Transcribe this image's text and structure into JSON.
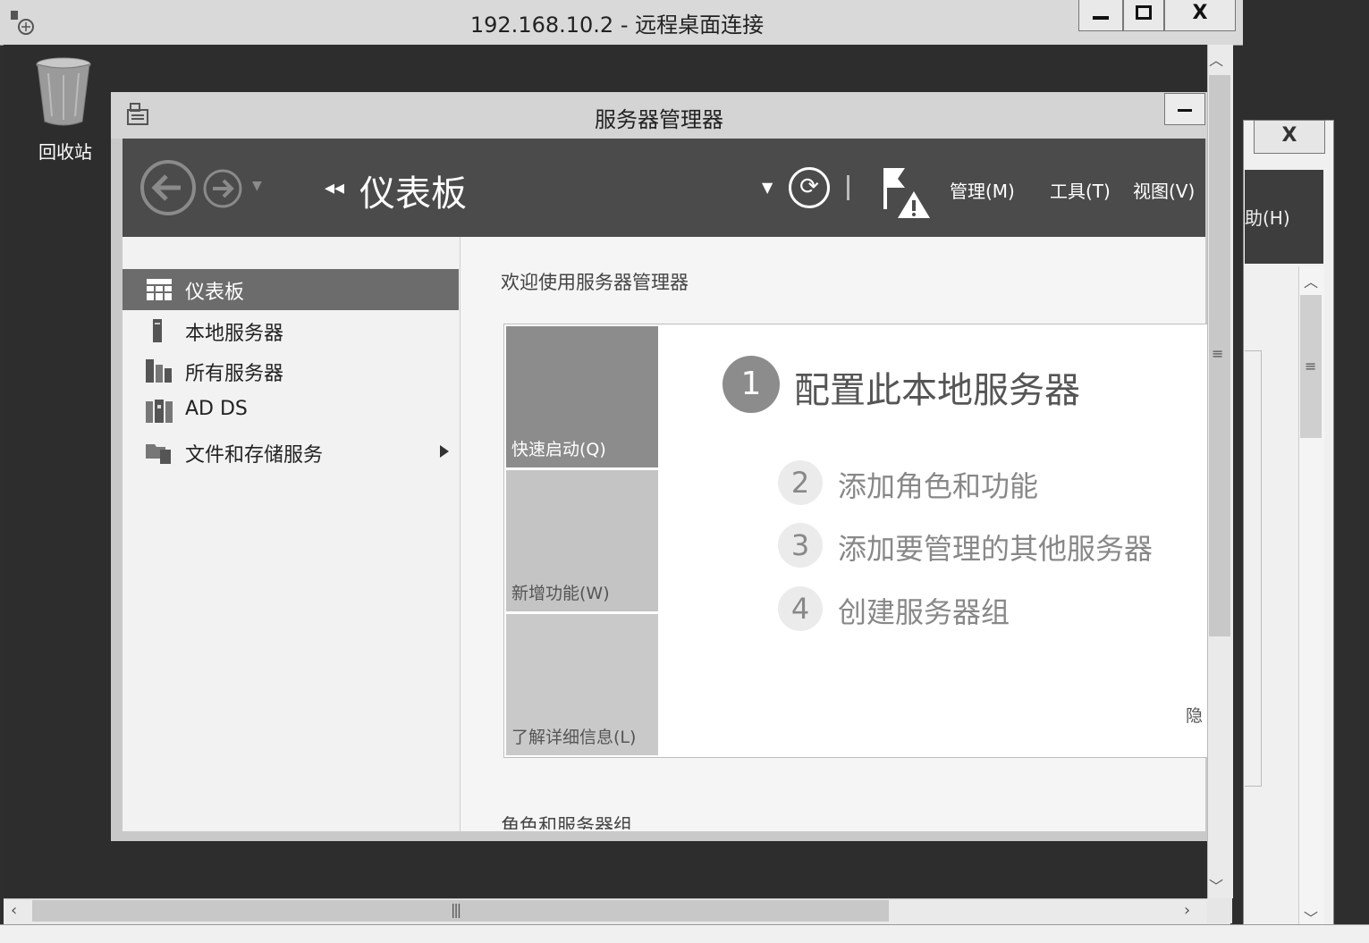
{
  "rdp": {
    "title": "192.168.10.2 - 远程桌面连接",
    "minimize": "▁",
    "maximize": "□",
    "close": "X"
  },
  "desktop": {
    "recycle_bin_label": "回收站"
  },
  "background_window": {
    "close": "X",
    "help_menu_partial": "助(H)"
  },
  "server_manager": {
    "title": "服务器管理器",
    "breadcrumb": "仪表板",
    "menus": [
      "管理(M)",
      "工具(T)",
      "视图(V)"
    ],
    "nav": [
      {
        "label": "仪表板",
        "icon": "dashboard-icon",
        "selected": true
      },
      {
        "label": "本地服务器",
        "icon": "local-server-icon",
        "selected": false
      },
      {
        "label": "所有服务器",
        "icon": "all-servers-icon",
        "selected": false
      },
      {
        "label": "AD DS",
        "icon": "ad-ds-icon",
        "selected": false
      },
      {
        "label": "文件和存储服务",
        "icon": "file-storage-icon",
        "selected": false,
        "has_submenu": true
      }
    ],
    "welcome": "欢迎使用服务器管理器",
    "tiles": [
      "快速启动(Q)",
      "新增功能(W)",
      "了解详细信息(L)"
    ],
    "steps": [
      {
        "num": "1",
        "text": "配置此本地服务器"
      },
      {
        "num": "2",
        "text": "添加角色和功能"
      },
      {
        "num": "3",
        "text": "添加要管理的其他服务器"
      },
      {
        "num": "4",
        "text": "创建服务器组"
      }
    ],
    "hide_label": "隐",
    "roles_heading": "角色和服务器组"
  },
  "colors": {
    "toolbar": "#4b4b4b",
    "selected_nav": "#6c6c6c",
    "tile_primary": "#8c8c8c"
  }
}
